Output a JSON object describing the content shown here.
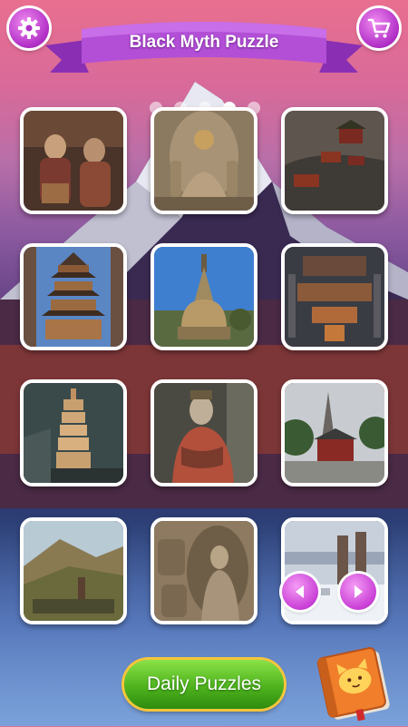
{
  "header": {
    "title": "Black Myth Puzzle",
    "settings_icon": "gear-icon",
    "shop_icon": "cart-icon"
  },
  "pager": {
    "pages": 4,
    "active": 3
  },
  "puzzles": [
    {
      "subject": "painted temple statues"
    },
    {
      "subject": "seated stone buddha in grotto"
    },
    {
      "subject": "hanging cliff temple"
    },
    {
      "subject": "wooden pagoda"
    },
    {
      "subject": "white stupa"
    },
    {
      "subject": "temple complex aerial"
    },
    {
      "subject": "pagoda at dusk"
    },
    {
      "subject": "colorful clay statue"
    },
    {
      "subject": "twin pagodas with red wall"
    },
    {
      "subject": "mountain valley pagoda"
    },
    {
      "subject": "carved grotto buddha"
    },
    {
      "subject": "snowy twin pagodas"
    }
  ],
  "buttons": {
    "daily_puzzles": "Daily Puzzles",
    "prev_icon": "chevron-left-icon",
    "next_icon": "chevron-right-icon",
    "collection_icon": "cat-book-icon"
  },
  "colors": {
    "accent": "#c03ad0",
    "daily_button": "#4fb31e",
    "daily_border": "#f5c63a"
  }
}
